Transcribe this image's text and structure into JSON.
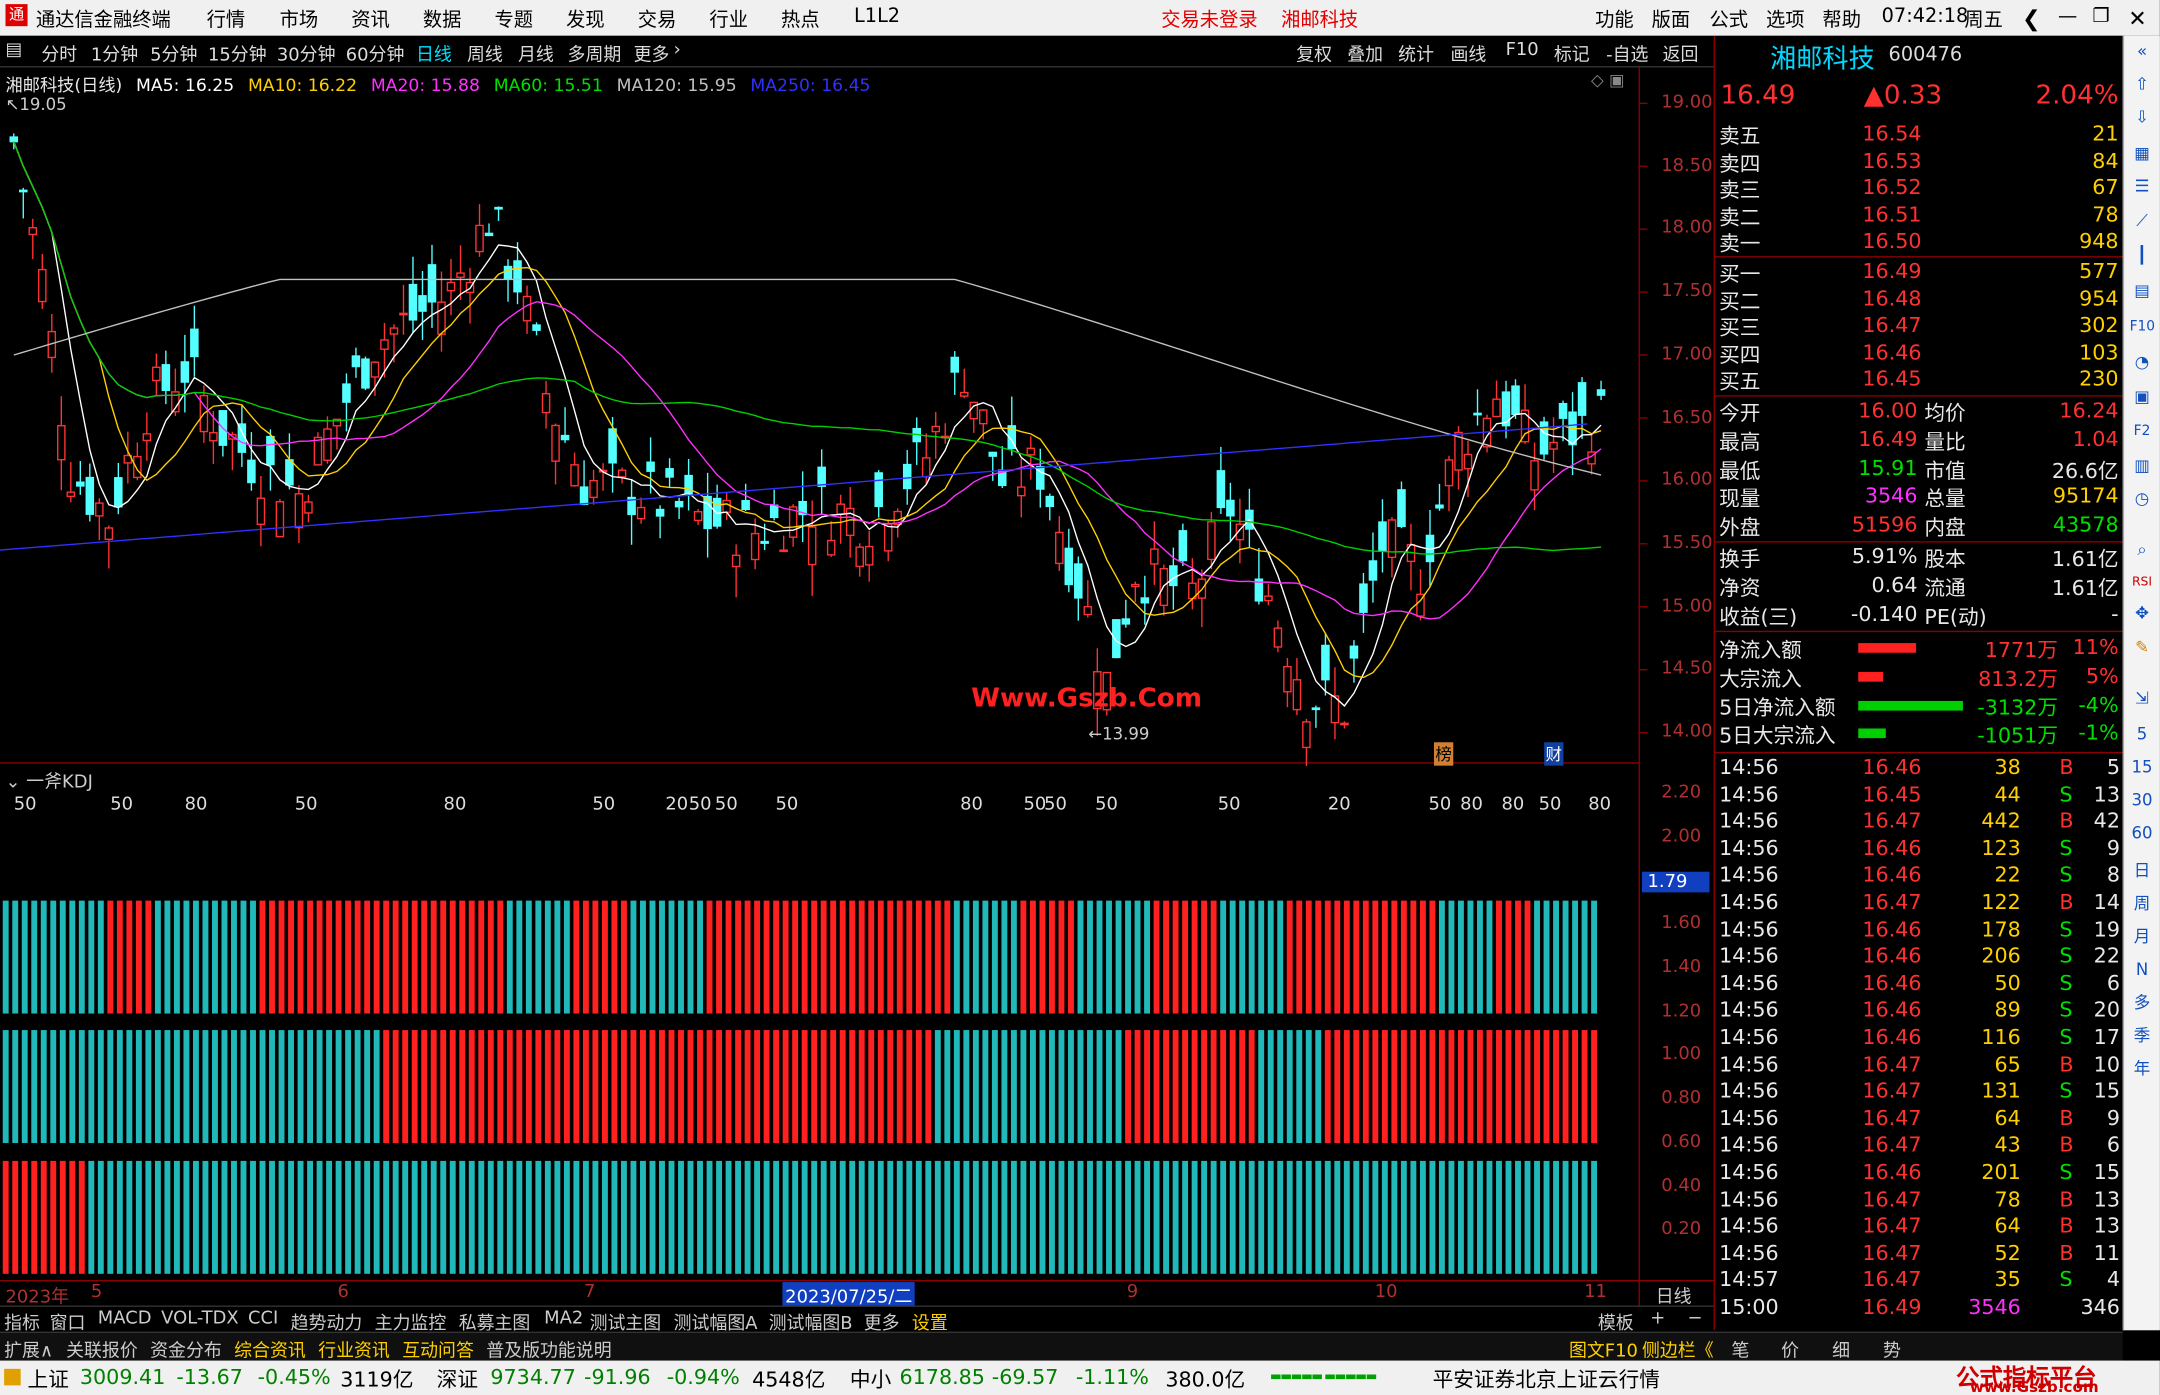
{
  "app": {
    "title": "通达信金融终端",
    "menu": [
      "行情",
      "市场",
      "资讯",
      "数据",
      "专题",
      "发现",
      "交易",
      "行业",
      "热点",
      "L1L2"
    ],
    "login": "交易未登录",
    "stock": "湘邮科技",
    "right_menu": [
      "功能",
      "版面",
      "公式",
      "选项",
      "帮助"
    ],
    "time": "07:42:18",
    "weekday": "周五"
  },
  "periods": [
    "分时",
    "1分钟",
    "5分钟",
    "15分钟",
    "30分钟",
    "60分钟",
    "日线",
    "周线",
    "月线",
    "多周期",
    "更多"
  ],
  "tools": [
    "复权",
    "叠加",
    "统计",
    "画线",
    "F10",
    "标记",
    "-自选",
    "返回"
  ],
  "ma_legend": {
    "name": "湘邮科技(日线)",
    "ma5": "MA5: 16.25",
    "ma10": "MA10: 16.22",
    "ma20": "MA20: 15.88",
    "ma60": "MA60: 15.51",
    "ma120": "MA120: 15.95",
    "ma250": "MA250: 16.45"
  },
  "price_axis": [
    "19.00",
    "18.50",
    "18.00",
    "17.50",
    "17.00",
    "16.50",
    "16.00",
    "15.50",
    "15.00",
    "14.50",
    "14.00"
  ],
  "chart_marks": {
    "high": "19.05",
    "low": "13.99",
    "watermark": "Www.Gszb.Com",
    "tag1": "榜",
    "tag2": "财"
  },
  "kdj": {
    "title": "一斧KDJ",
    "axis": [
      "2.20",
      "2.00",
      "1.79",
      "1.60",
      "1.40",
      "1.20",
      "1.00",
      "0.80",
      "0.60",
      "0.40",
      "0.20"
    ],
    "current": "1.79",
    "labels": [
      "50",
      "50",
      "80",
      "50",
      "80",
      "50",
      "20",
      "50",
      "50",
      "50",
      "80",
      "50",
      "50",
      "50",
      "50",
      "20",
      "50",
      "80",
      "80",
      "50",
      "80"
    ]
  },
  "xaxis": [
    "2023年",
    "5",
    "6",
    "7",
    "2023/07/25/二",
    "9",
    "10",
    "11"
  ],
  "period_label": "日线",
  "quote": {
    "name": "湘邮科技",
    "code": "600476",
    "price": "16.49",
    "change": "▲0.33",
    "pct": "2.04%",
    "asks": [
      {
        "l": "卖五",
        "p": "16.54",
        "v": "21"
      },
      {
        "l": "卖四",
        "p": "16.53",
        "v": "84"
      },
      {
        "l": "卖三",
        "p": "16.52",
        "v": "67"
      },
      {
        "l": "卖二",
        "p": "16.51",
        "v": "78"
      },
      {
        "l": "卖一",
        "p": "16.50",
        "v": "948"
      }
    ],
    "bids": [
      {
        "l": "买一",
        "p": "16.49",
        "v": "577"
      },
      {
        "l": "买二",
        "p": "16.48",
        "v": "954"
      },
      {
        "l": "买三",
        "p": "16.47",
        "v": "302"
      },
      {
        "l": "买四",
        "p": "16.46",
        "v": "103"
      },
      {
        "l": "买五",
        "p": "16.45",
        "v": "230"
      }
    ],
    "stats": [
      [
        "今开",
        "16.00",
        "均价",
        "16.24"
      ],
      [
        "最高",
        "16.49",
        "量比",
        "1.04"
      ],
      [
        "最低",
        "15.91",
        "市值",
        "26.6亿"
      ],
      [
        "现量",
        "3546",
        "总量",
        "95174"
      ],
      [
        "外盘",
        "51596",
        "内盘",
        "43578"
      ]
    ],
    "stats2": [
      [
        "换手",
        "5.91%",
        "股本",
        "1.61亿"
      ],
      [
        "净资",
        "0.64",
        "流通",
        "1.61亿"
      ],
      [
        "收益(三)",
        "-0.140",
        "PE(动)",
        "-"
      ]
    ],
    "flows": [
      {
        "l": "净流入额",
        "v": "1771万",
        "p": "11%",
        "w": 42,
        "c": "red"
      },
      {
        "l": "大宗流入",
        "v": "813.2万",
        "p": "5%",
        "w": 18,
        "c": "red"
      },
      {
        "l": "5日净流入额",
        "v": "-3132万",
        "p": "-4%",
        "w": 76,
        "c": "grn"
      },
      {
        "l": "5日大宗流入",
        "v": "-1051万",
        "p": "-1%",
        "w": 20,
        "c": "grn"
      }
    ],
    "ticks": [
      [
        "14:56",
        "16.46",
        "38",
        "B",
        "5"
      ],
      [
        "14:56",
        "16.45",
        "44",
        "S",
        "13"
      ],
      [
        "14:56",
        "16.47",
        "442",
        "B",
        "42"
      ],
      [
        "14:56",
        "16.46",
        "123",
        "S",
        "9"
      ],
      [
        "14:56",
        "16.46",
        "22",
        "S",
        "8"
      ],
      [
        "14:56",
        "16.47",
        "122",
        "B",
        "14"
      ],
      [
        "14:56",
        "16.46",
        "178",
        "S",
        "19"
      ],
      [
        "14:56",
        "16.46",
        "206",
        "S",
        "22"
      ],
      [
        "14:56",
        "16.46",
        "50",
        "S",
        "6"
      ],
      [
        "14:56",
        "16.46",
        "89",
        "S",
        "20"
      ],
      [
        "14:56",
        "16.46",
        "116",
        "S",
        "17"
      ],
      [
        "14:56",
        "16.47",
        "65",
        "B",
        "10"
      ],
      [
        "14:56",
        "16.47",
        "131",
        "S",
        "15"
      ],
      [
        "14:56",
        "16.47",
        "64",
        "B",
        "9"
      ],
      [
        "14:56",
        "16.47",
        "43",
        "B",
        "6"
      ],
      [
        "14:56",
        "16.46",
        "201",
        "S",
        "15"
      ],
      [
        "14:56",
        "16.47",
        "78",
        "B",
        "13"
      ],
      [
        "14:56",
        "16.47",
        "64",
        "B",
        "13"
      ],
      [
        "14:56",
        "16.47",
        "52",
        "B",
        "11"
      ],
      [
        "14:57",
        "16.47",
        "35",
        "S",
        "4"
      ],
      [
        "15:00",
        "16.49",
        "3546",
        "",
        "346"
      ]
    ]
  },
  "bottom_tabs": [
    "指标",
    "窗口",
    "MACD",
    "VOL-TDX",
    "CCI",
    "趋势动力",
    "主力监控",
    "私募主图",
    "MA2",
    "测试主图",
    "测试幅图A",
    "测试幅图B",
    "更多",
    "设置"
  ],
  "template_label": "模板",
  "bottom_tabs2": [
    "扩展∧",
    "关联报价",
    "资金分布",
    "综合资讯",
    "行业资讯",
    "互动问答",
    "普及版功能说明"
  ],
  "side_links": {
    "f10": "图文F10",
    "side": "侧边栏《"
  },
  "right_tabs": [
    "笔",
    "价",
    "细",
    "势"
  ],
  "sidebar_icons": [
    "日",
    "周",
    "月",
    "N",
    "多",
    "季",
    "年",
    "5",
    "15",
    "30",
    "60",
    "RSI"
  ],
  "status": {
    "sh_name": "上证",
    "sh": "3009.41",
    "sh_c": "-13.67",
    "sh_p": "-0.45%",
    "sh_v": "3119亿",
    "sz_name": "深证",
    "sz": "9734.77",
    "sz_c": "-91.96",
    "sz_p": "-0.94%",
    "sz_v": "4548亿",
    "zx_name": "中小",
    "zx": "6178.85",
    "zx_c": "-69.57",
    "zx_p": "-1.11%",
    "zx_v": "380.0亿",
    "broker": "平安证券北京上证云行情",
    "logo": "公式指标平台",
    "logo_url": "www.Gszb.com"
  },
  "chart_data": {
    "type": "candlestick",
    "ylim": [
      13.8,
      19.2
    ],
    "ma_colors": {
      "ma5": "#ffffff",
      "ma10": "#ffd000",
      "ma20": "#ff30ff",
      "ma60": "#00d000",
      "ma120": "#c0c0c0",
      "ma250": "#3030ff"
    }
  }
}
